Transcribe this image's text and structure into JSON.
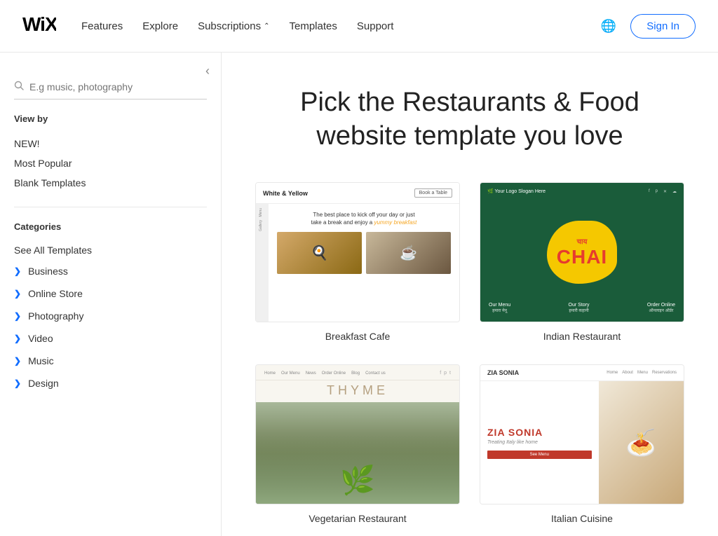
{
  "nav": {
    "logo": "WiX",
    "links": [
      {
        "label": "Features",
        "hasArrow": false
      },
      {
        "label": "Explore",
        "hasArrow": false
      },
      {
        "label": "Subscriptions",
        "hasArrow": true
      },
      {
        "label": "Templates",
        "hasArrow": false
      },
      {
        "label": "Support",
        "hasArrow": false
      }
    ],
    "signin_label": "Sign In",
    "globe_label": "🌐"
  },
  "sidebar": {
    "collapse_icon": "<",
    "search_placeholder": "E.g music, photography",
    "view_by_label": "View by",
    "filter_items": [
      {
        "label": "NEW!"
      },
      {
        "label": "Most Popular"
      },
      {
        "label": "Blank Templates"
      }
    ],
    "categories_label": "Categories",
    "see_all_label": "See All Templates",
    "category_items": [
      {
        "label": "Business"
      },
      {
        "label": "Online Store"
      },
      {
        "label": "Photography"
      },
      {
        "label": "Video"
      },
      {
        "label": "Music"
      },
      {
        "label": "Design"
      }
    ]
  },
  "main": {
    "title": "Pick the Restaurants & Food\nwebsite template you love",
    "templates": [
      {
        "id": "breakfast-cafe",
        "name": "Breakfast Cafe",
        "type": "breakfast"
      },
      {
        "id": "indian-restaurant",
        "name": "Indian Restaurant",
        "type": "indian"
      },
      {
        "id": "vegetarian-restaurant",
        "name": "Vegetarian Restaurant",
        "type": "thyme"
      },
      {
        "id": "italian-cuisine",
        "name": "Italian Cuisine",
        "type": "italian"
      }
    ]
  }
}
